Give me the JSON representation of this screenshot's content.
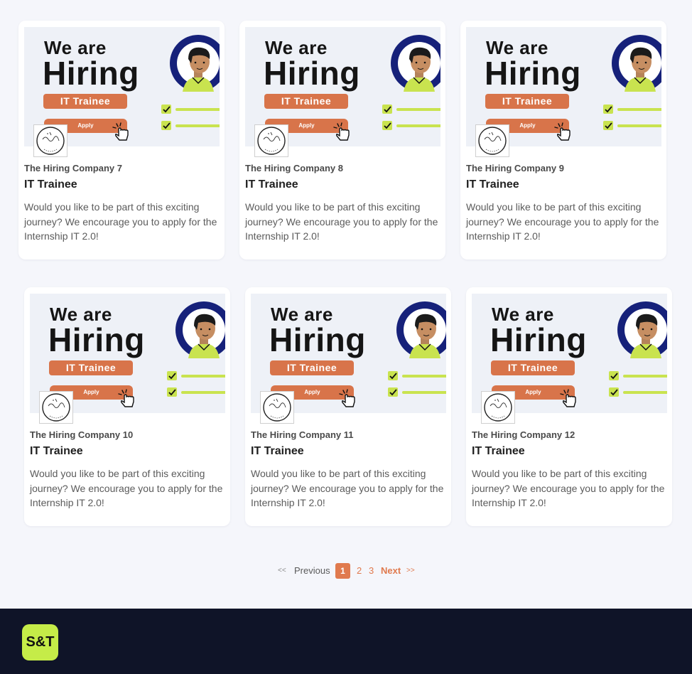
{
  "jobs": [
    {
      "company": "The Hiring Company 7",
      "title": "IT Trainee",
      "description": "Would you like to be part of this exciting journey? We encourage you to apply for the Internship IT 2.0!"
    },
    {
      "company": "The Hiring Company 8",
      "title": "IT Trainee",
      "description": "Would you like to be part of this exciting journey? We encourage you to apply for the Internship IT 2.0!"
    },
    {
      "company": "The Hiring Company 9",
      "title": "IT Trainee",
      "description": "Would you like to be part of this exciting journey? We encourage you to apply for the Internship IT 2.0!"
    },
    {
      "company": "The Hiring Company 10",
      "title": "IT Trainee",
      "description": "Would you like to be part of this exciting journey? We encourage you to apply for the Internship IT 2.0!"
    },
    {
      "company": "The Hiring Company 11",
      "title": "IT Trainee",
      "description": "Would you like to be part of this exciting journey? We encourage you to apply for the Internship IT 2.0!"
    },
    {
      "company": "The Hiring Company 12",
      "title": "IT Trainee",
      "description": "Would you like to be part of this exciting journey? We encourage you to apply for the Internship IT 2.0!"
    }
  ],
  "banner": {
    "line1": "We are",
    "line2": "Hiring",
    "role_pill": "IT Trainee",
    "apply_label": "Apply",
    "logo_text": "The Future Is Hire Company",
    "icons": [
      "avatar-ring-icon",
      "checkmark-icon",
      "hand-pointer-icon"
    ]
  },
  "pagination": {
    "prev_arrows": "<<",
    "prev_label": "Previous",
    "pages": [
      "1",
      "2",
      "3"
    ],
    "current_page": "1",
    "next_label": "Next",
    "next_arrows": ">>"
  },
  "footer": {
    "logo_text": "S&T"
  },
  "colors": {
    "accent": "#e07a4e",
    "banner_orange": "#d8744a",
    "ring_navy": "#16217a",
    "shirt_green": "#c9e34f",
    "footer_bg": "#0f1428",
    "footer_logo_bg": "#c5ec48",
    "page_bg": "#f5f6fb"
  }
}
